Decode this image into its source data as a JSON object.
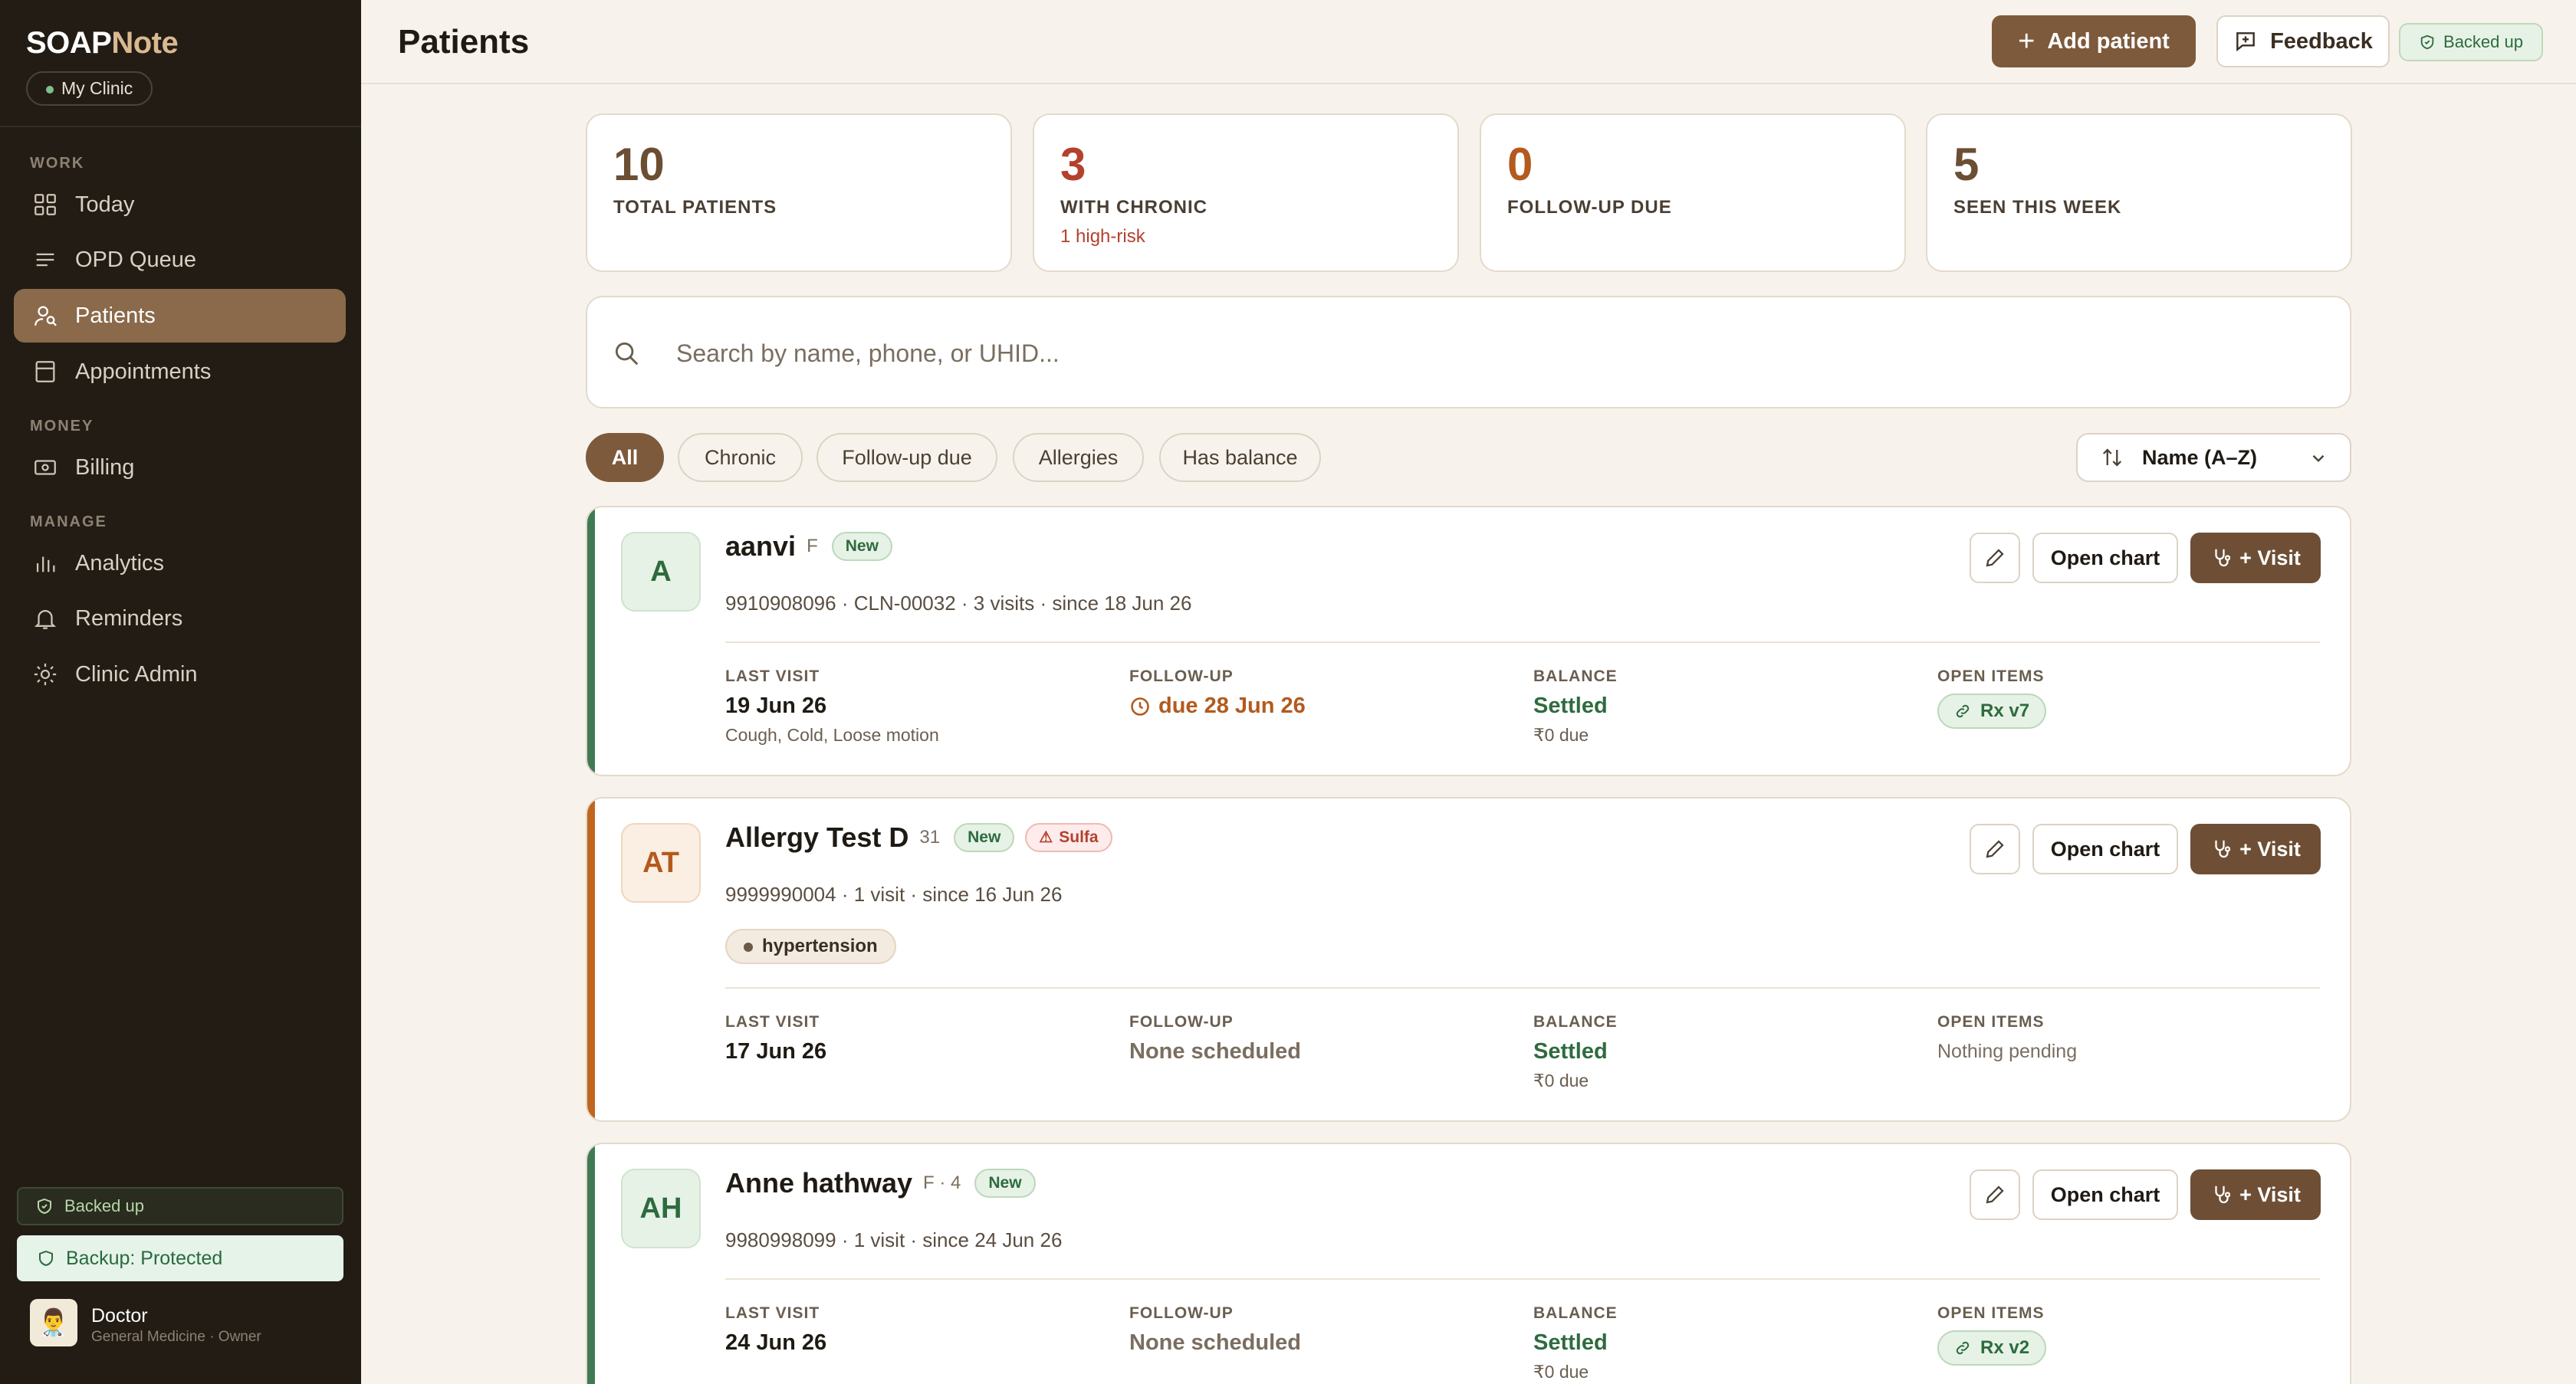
{
  "brand": {
    "soap": "SOAP",
    "note": "Note"
  },
  "clinic": "My Clinic",
  "nav": {
    "work_label": "WORK",
    "money_label": "MONEY",
    "manage_label": "MANAGE",
    "items": [
      {
        "label": "Today",
        "icon": "grid-icon"
      },
      {
        "label": "OPD Queue",
        "icon": "list-icon"
      },
      {
        "label": "Patients",
        "icon": "users-icon",
        "active": true
      },
      {
        "label": "Appointments",
        "icon": "calendar-icon"
      },
      {
        "label": "Billing",
        "icon": "banknote-icon"
      },
      {
        "label": "Analytics",
        "icon": "bar-chart-icon"
      },
      {
        "label": "Reminders",
        "icon": "bell-icon"
      },
      {
        "label": "Clinic Admin",
        "icon": "sun-gear-icon"
      }
    ]
  },
  "sidebar_footer": {
    "backed_up": "Backed up",
    "backup_protected": "Backup: Protected",
    "user_name": "Doctor",
    "user_role": "General Medicine · Owner"
  },
  "header": {
    "title": "Patients",
    "add_patient": "Add patient",
    "feedback": "Feedback",
    "backed_up": "Backed up"
  },
  "stats": [
    {
      "value": "10",
      "label": "TOTAL PATIENTS",
      "sub": "",
      "color": "#6b4e33"
    },
    {
      "value": "3",
      "label": "WITH CHRONIC",
      "sub": "1 high-risk",
      "color": "#b3412d"
    },
    {
      "value": "0",
      "label": "FOLLOW-UP DUE",
      "sub": "",
      "color": "#b35a1d"
    },
    {
      "value": "5",
      "label": "SEEN THIS WEEK",
      "sub": "",
      "color": "#6b4e33"
    }
  ],
  "search": {
    "placeholder": "Search by name, phone, or UHID..."
  },
  "filters": [
    "All",
    "Chronic",
    "Follow-up due",
    "Allergies",
    "Has balance"
  ],
  "sort": {
    "label": "Name (A–Z)"
  },
  "columns": {
    "last_visit": "LAST VISIT",
    "follow_up": "FOLLOW-UP",
    "balance": "BALANCE",
    "open_items": "OPEN ITEMS"
  },
  "actions": {
    "open_chart": "Open chart",
    "visit": "+ Visit"
  },
  "patients": [
    {
      "initials": "A",
      "name": "aanvi",
      "meta": "F",
      "badge": "New",
      "details": "9910908096 · CLN-00032 · 3 visits · since 18 Jun 26",
      "last_visit": "19 Jun 26",
      "last_visit_note": "Cough, Cold, Loose motion",
      "follow_up": "due 28 Jun 26",
      "balance": "Settled",
      "balance_due": "₹0 due",
      "open_item": "Rx v7",
      "accent": "#3f7a55"
    },
    {
      "initials": "AT",
      "name": "Allergy Test D",
      "meta": "31",
      "badge": "New",
      "allergy": "Sulfa",
      "details": "9999990004 · 1 visit · since 16 Jun 26",
      "condition": "hypertension",
      "last_visit": "17 Jun 26",
      "follow_up": "None scheduled",
      "balance": "Settled",
      "balance_due": "₹0 due",
      "open_item": "Nothing pending",
      "accent": "#c0661f"
    },
    {
      "initials": "AH",
      "name": "Anne hathway",
      "meta": "F · 4",
      "badge": "New",
      "details": "9980998099 · 1 visit · since 24 Jun 26",
      "last_visit": "24 Jun 26",
      "follow_up": "None scheduled",
      "balance": "Settled",
      "balance_due": "₹0 due",
      "open_item": "Rx v2",
      "accent": "#3f7a55"
    }
  ]
}
